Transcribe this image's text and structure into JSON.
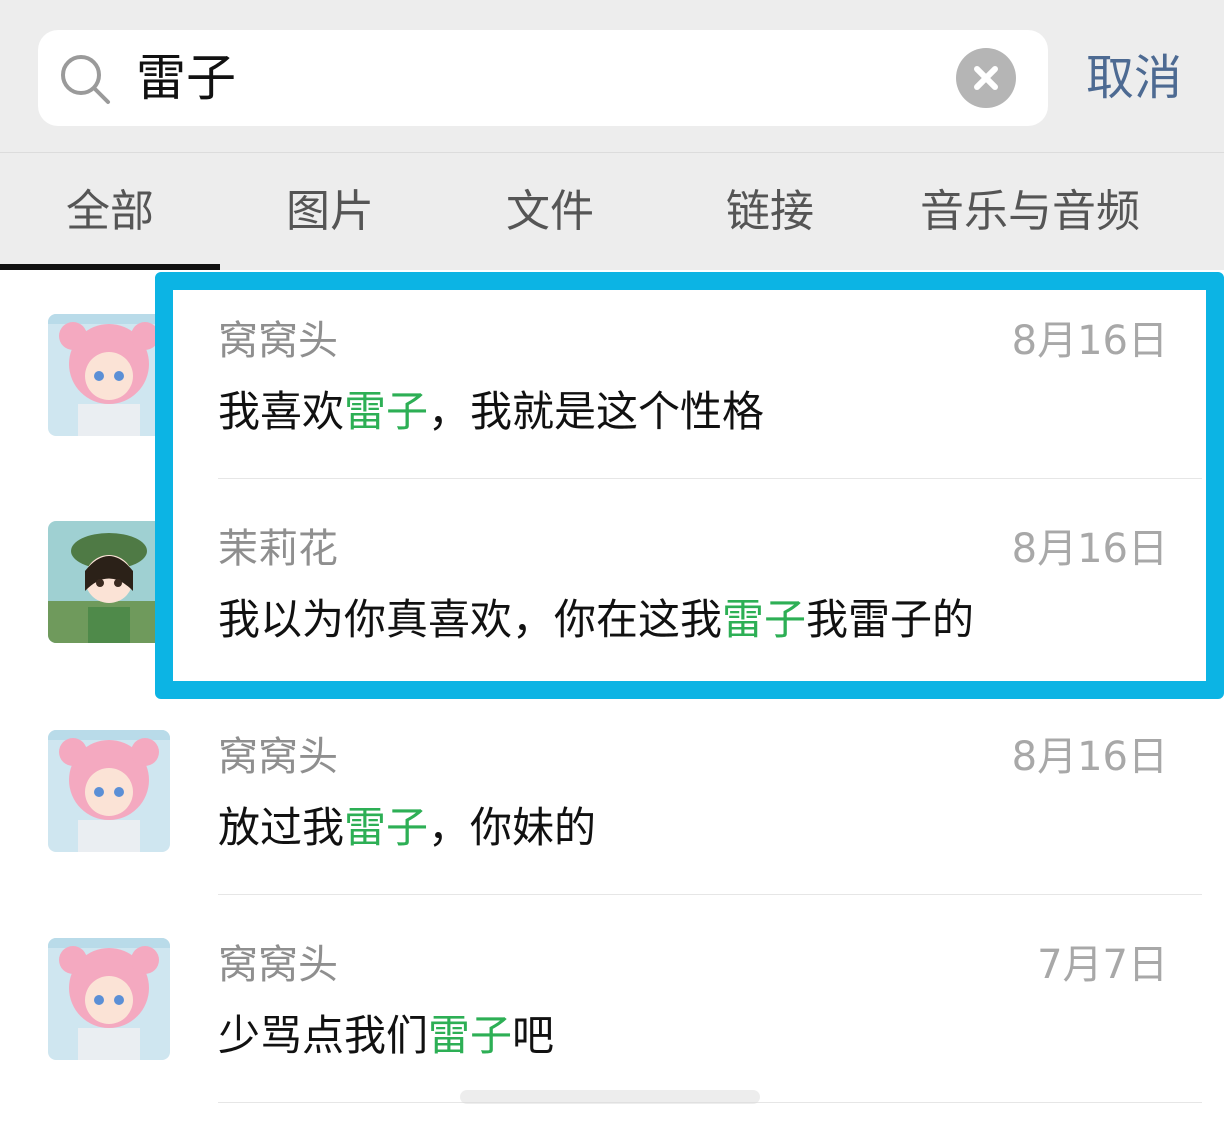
{
  "search": {
    "query": "雷子",
    "cancel_label": "取消"
  },
  "tabs": [
    {
      "label": "全部",
      "active": true
    },
    {
      "label": "图片",
      "active": false
    },
    {
      "label": "文件",
      "active": false
    },
    {
      "label": "链接",
      "active": false
    },
    {
      "label": "音乐与音频",
      "active": false
    }
  ],
  "results": [
    {
      "name": "窝窝头",
      "date": "8月16日",
      "msg_before": "我喜欢",
      "highlight": "雷子",
      "msg_after": "，我就是这个性格",
      "avatar": "pink-bear-girl"
    },
    {
      "name": "茉莉花",
      "date": "8月16日",
      "msg_before": "我以为你真喜欢，你在这我",
      "highlight": "雷子",
      "msg_after": "我雷子的",
      "avatar": "green-hat-girl"
    },
    {
      "name": "窝窝头",
      "date": "8月16日",
      "msg_before": "放过我",
      "highlight": "雷子",
      "msg_after": "，你妹的",
      "avatar": "pink-bear-girl"
    },
    {
      "name": "窝窝头",
      "date": "7月7日",
      "msg_before": "少骂点我们",
      "highlight": "雷子",
      "msg_after": "吧",
      "avatar": "pink-bear-girl"
    }
  ],
  "colors": {
    "highlight_text": "#2daf55",
    "frame": "#0cb4e4",
    "cancel": "#4d6a92"
  }
}
